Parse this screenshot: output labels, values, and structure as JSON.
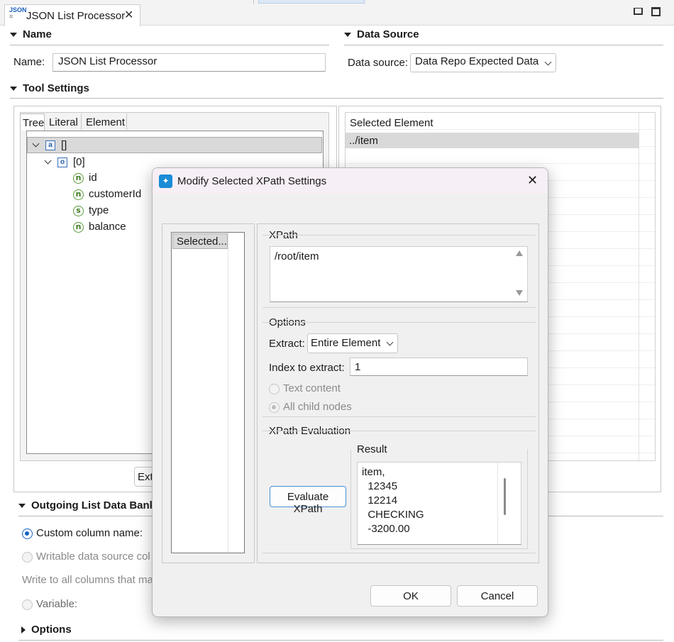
{
  "tab": {
    "icon_text": "JSON",
    "title": "JSON List Processor"
  },
  "name_section": {
    "header": "Name",
    "name_label": "Name:",
    "name_value": "JSON List Processor"
  },
  "data_source_section": {
    "header": "Data Source",
    "label": "Data source:",
    "value": "Data Repo Expected Data"
  },
  "tool_settings": {
    "header": "Tool Settings",
    "tabs": [
      "Tree",
      "Literal",
      "Element"
    ],
    "tree": [
      {
        "icon": "a",
        "label": "[]"
      },
      {
        "icon": "o",
        "label": "[0]"
      },
      {
        "icon": "n",
        "label": "id"
      },
      {
        "icon": "n",
        "label": "customerId"
      },
      {
        "icon": "s",
        "label": "type"
      },
      {
        "icon": "n",
        "label": "balance"
      }
    ],
    "extract_button": "Ext",
    "selected_header": "Selected Element",
    "selected_rows": [
      "../item"
    ]
  },
  "outgoing": {
    "header": "Outgoing List Data Bank",
    "custom_column": "Custom column name:",
    "writable": "Writable data source col",
    "write_all": "Write to all columns that ma",
    "variable": "Variable:"
  },
  "options_section": {
    "header": "Options"
  },
  "dialog": {
    "title": "Modify Selected XPath Settings",
    "list_item": "Selected...",
    "xpath_group": "XPath",
    "xpath_value": "/root/item",
    "options_group": "Options",
    "extract_label": "Extract:",
    "extract_value": "Entire Element",
    "index_label": "Index to extract:",
    "index_value": "1",
    "text_content": "Text content",
    "all_child_nodes": "All child nodes",
    "evaluation_group": "XPath Evaluation",
    "evaluate_button": "Evaluate XPath",
    "result_group": "Result",
    "result_lines": [
      "item,",
      "  12345",
      "  12214",
      "  CHECKING",
      "  -3200.00"
    ],
    "ok": "OK",
    "cancel": "Cancel"
  }
}
